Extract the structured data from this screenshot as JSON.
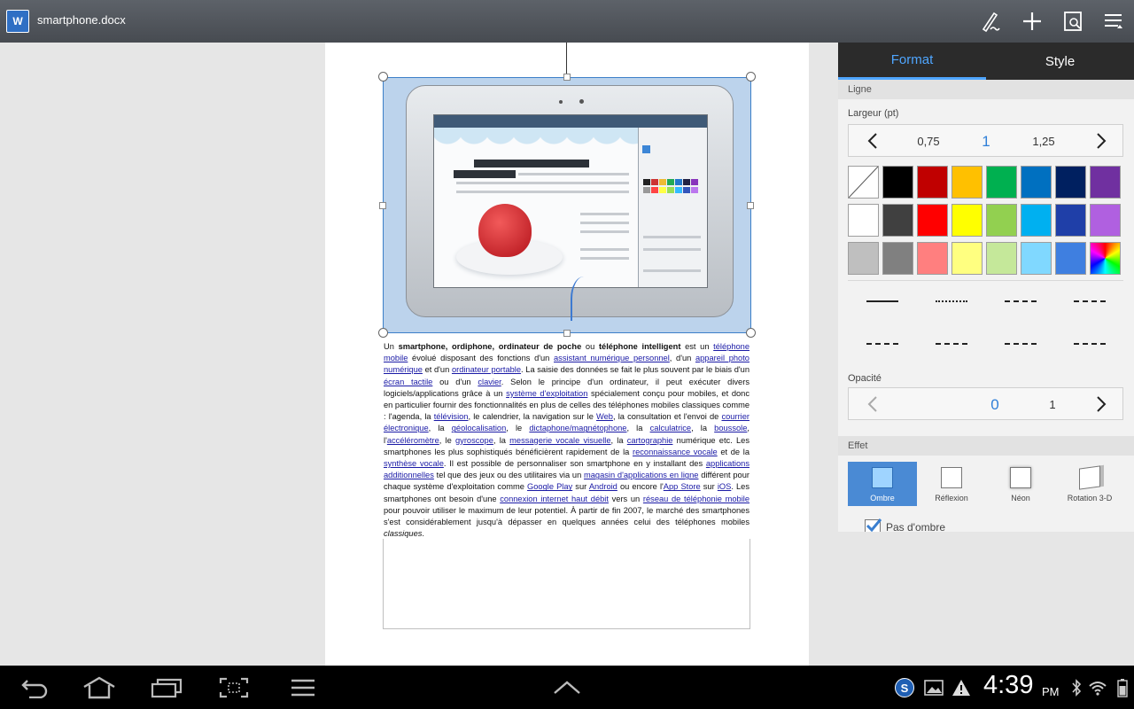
{
  "app": {
    "title": "smartphone.docx",
    "icon_label": "W"
  },
  "toolbar": {
    "icons": [
      "pen-icon",
      "plus-icon",
      "save-icon",
      "menu-icon"
    ]
  },
  "document": {
    "paragraph": [
      {
        "t": "Un "
      },
      {
        "b": "smartphone, ordiphone, ordinateur de poche"
      },
      {
        "t": " ou "
      },
      {
        "b": "téléphone intelligent"
      },
      {
        "t": " est un "
      },
      {
        "a": "téléphone mobile"
      },
      {
        "t": " évolué disposant des fonctions d'un "
      },
      {
        "a": "assistant numérique personnel"
      },
      {
        "t": ", d'un "
      },
      {
        "a": "appareil photo numérique"
      },
      {
        "t": " et d'un "
      },
      {
        "a": "ordinateur portable"
      },
      {
        "t": ". La saisie des données se fait le plus souvent par le biais d'un "
      },
      {
        "a": "écran tactile"
      },
      {
        "t": " ou d'un "
      },
      {
        "a": "clavier"
      },
      {
        "t": ". Selon le principe d'un ordinateur, il peut exécuter divers logiciels/applications grâce à un "
      },
      {
        "a": "système d'exploitation"
      },
      {
        "t": " spécialement conçu pour mobiles, et donc en particulier fournir des fonctionnalités en plus de celles des téléphones mobiles classiques comme : l'agenda, la "
      },
      {
        "a": "télévision"
      },
      {
        "t": ", le calendrier, la navigation sur le "
      },
      {
        "a": "Web"
      },
      {
        "t": ", la consultation et l'envoi de "
      },
      {
        "a": "courrier électronique"
      },
      {
        "t": ", la "
      },
      {
        "a": "géolocalisation"
      },
      {
        "t": ", le "
      },
      {
        "a": "dictaphone/magnétophone"
      },
      {
        "t": ", la "
      },
      {
        "a": "calculatrice"
      },
      {
        "t": ", la "
      },
      {
        "a": "boussole"
      },
      {
        "t": ", l'"
      },
      {
        "a": "accéléromètre"
      },
      {
        "t": ", le "
      },
      {
        "a": "gyroscope"
      },
      {
        "t": ", la "
      },
      {
        "a": "messagerie vocale visuelle"
      },
      {
        "t": ", la "
      },
      {
        "a": "cartographie"
      },
      {
        "t": " numérique etc. Les smartphones les plus sophistiqués bénéficièrent rapidement de la "
      },
      {
        "a": "reconnaissance vocale"
      },
      {
        "t": " et de la "
      },
      {
        "a": "synthèse vocale"
      },
      {
        "t": ". Il est possible de personnaliser son smartphone en y installant des "
      },
      {
        "a": "applications additionnelles"
      },
      {
        "t": " tel que des jeux ou des utilitaires via un "
      },
      {
        "a": "magasin d'applications en ligne"
      },
      {
        "t": " différent pour chaque système d'exploitation comme "
      },
      {
        "a": "Google Play"
      },
      {
        "t": " sur "
      },
      {
        "a": "Android"
      },
      {
        "t": " ou encore l'"
      },
      {
        "a": "App Store"
      },
      {
        "t": " sur "
      },
      {
        "a": "iOS"
      },
      {
        "t": ". Les smartphones ont besoin d'une "
      },
      {
        "a": "connexion internet haut débit"
      },
      {
        "t": " vers un "
      },
      {
        "a": "réseau de téléphonie mobile"
      },
      {
        "t": " pour pouvoir utiliser le maximum de leur potentiel. À partir de fin 2007, le marché des smartphones s'est considérablement jusqu'à dépasser en quelques années celui des téléphones mobiles "
      },
      {
        "i": "classiques"
      },
      {
        "t": "."
      }
    ]
  },
  "panel": {
    "tabs": [
      {
        "label": "Format",
        "active": true
      },
      {
        "label": "Style",
        "active": false
      }
    ],
    "section_line": "Ligne",
    "width_label": "Largeur (pt)",
    "width_values": [
      "0,75",
      "1",
      "1,25"
    ],
    "colors": [
      [
        "none",
        "#000000",
        "#c00000",
        "#ffc000",
        "#00b050",
        "#0070c0",
        "#002060",
        "#7030a0"
      ],
      [
        "#ffffff",
        "#404040",
        "#ff0000",
        "#ffff00",
        "#92d050",
        "#00b0f0",
        "#1f3fa8",
        "#b060e0"
      ],
      [
        "#bfbfbf",
        "#808080",
        "#ff7f7f",
        "#ffff80",
        "#c5e89a",
        "#80d8ff",
        "#3f7fe0",
        "rainbow"
      ]
    ],
    "line_styles": [
      "solid",
      "dotted-fine",
      "dotted",
      "dashed-short",
      "dash-dot-small",
      "dashed-long",
      "dash-dot",
      "long-dash-dot"
    ],
    "opacity_label": "Opacité",
    "opacity_values": [
      "0",
      "1"
    ],
    "section_effect": "Effet",
    "effects": [
      {
        "label": "Ombre",
        "active": true
      },
      {
        "label": "Réflexion",
        "active": false
      },
      {
        "label": "Néon",
        "active": false
      },
      {
        "label": "Rotation 3-D",
        "active": false
      }
    ],
    "checkbox_label": "Pas d'ombre"
  },
  "system": {
    "time": "4:39",
    "ampm": "PM"
  }
}
